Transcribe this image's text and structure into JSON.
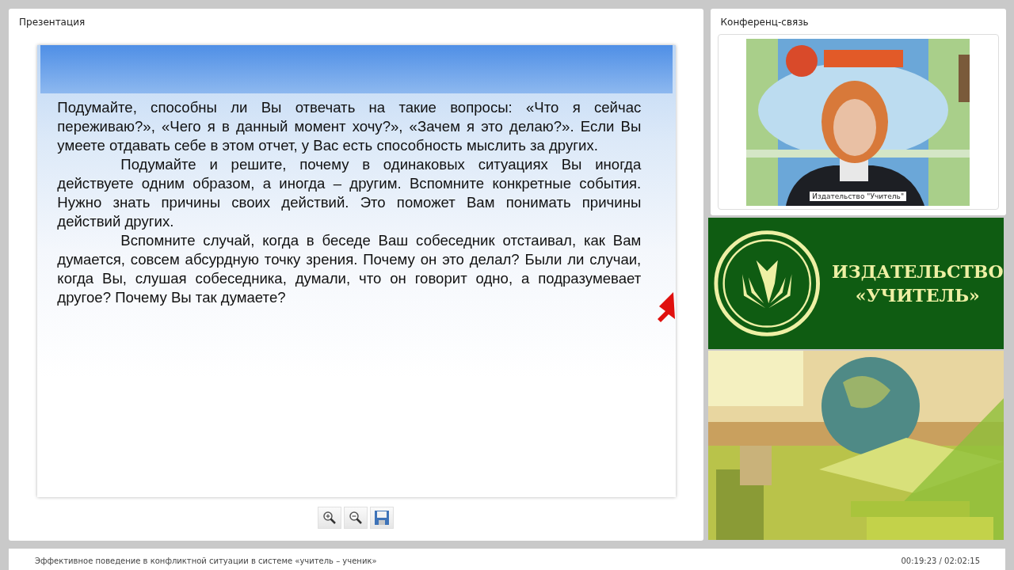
{
  "presentation": {
    "title": "Презентация",
    "paragraphs": [
      {
        "text": "Подумайте, способны ли Вы отвечать на такие вопросы: «Что я сейчас переживаю?», «Чего я в данный момент хочу?», «Зачем я это делаю?». Если Вы умеете отдавать себе в этом отчет, у Вас есть способность мыслить за других.",
        "indented": false
      },
      {
        "text": "Подумайте и решите, почему в одинаковых ситуациях Вы  иногда действуете одним образом, а иногда – другим. Вспомните конкретные события. Нужно знать причины своих действий. Это поможет Вам понимать причины действий других.",
        "indented": true
      },
      {
        "text": "Вспомните случай, когда в беседе Ваш собеседник отстаивал, как Вам думается, совсем абсурдную точку зрения. Почему он это делал? Были ли случаи, когда Вы, слушая собеседника, думали, что он говорит одно, а подразумевает другое? Почему Вы так думаете?",
        "indented": true
      }
    ],
    "tools": [
      {
        "kind": "zoom-in"
      },
      {
        "kind": "zoom-out"
      },
      {
        "kind": "save"
      }
    ]
  },
  "conference": {
    "title": "Конференц-связь",
    "caption": "Издательство \"Учитель\""
  },
  "banner": {
    "line_1": "ИЗДАТЕЛЬСТВО",
    "line_2": "«УЧИТЕЛЬ»"
  },
  "status_bar": {
    "title": "Эффективное поведение в конфликтной ситуации в системе «учитель – ученик»",
    "time": "00:19:23 / 02:02:15"
  }
}
